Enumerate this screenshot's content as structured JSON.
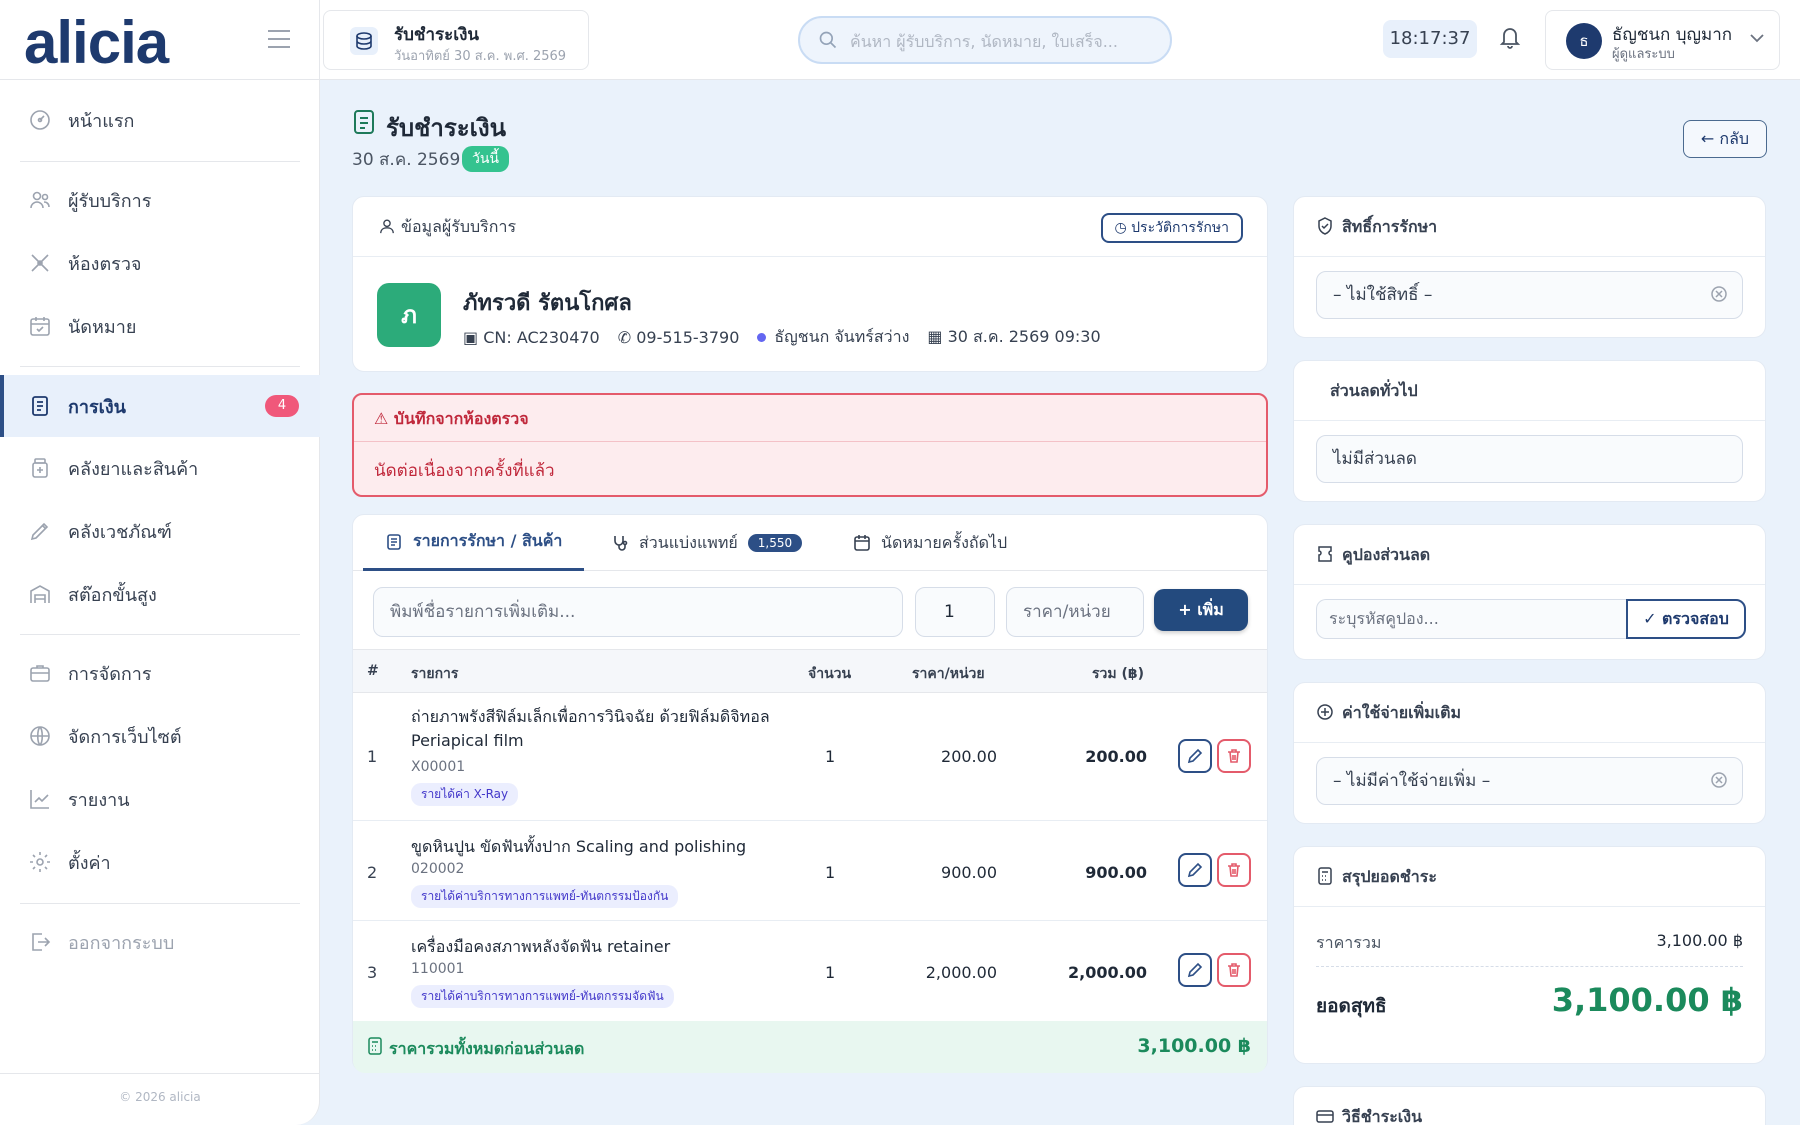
{
  "app": {
    "logo": "alicia",
    "copyright": "© 2026 alicia"
  },
  "sidebar": {
    "items": [
      {
        "label": "หน้าแรก",
        "icon": "dashboard-icon"
      },
      {
        "label": "ผู้รับบริการ",
        "icon": "users-icon"
      },
      {
        "label": "ห้องตรวจ",
        "icon": "exam-room-icon"
      },
      {
        "label": "นัดหมาย",
        "icon": "calendar-icon"
      },
      {
        "label": "การเงิน",
        "icon": "receipt-icon",
        "badge": "4",
        "active": true
      },
      {
        "label": "คลังยาและสินค้า",
        "icon": "medicine-icon"
      },
      {
        "label": "คลังเวชภัณฑ์",
        "icon": "supply-icon"
      },
      {
        "label": "สต๊อกขั้นสูง",
        "icon": "warehouse-icon"
      },
      {
        "label": "การจัดการ",
        "icon": "briefcase-icon"
      },
      {
        "label": "จัดการเว็บไซต์",
        "icon": "globe-icon"
      },
      {
        "label": "รายงาน",
        "icon": "chart-icon"
      },
      {
        "label": "ตั้งค่า",
        "icon": "gear-icon"
      },
      {
        "label": "ออกจากระบบ",
        "icon": "logout-icon"
      }
    ]
  },
  "header": {
    "page_tag_title": "รับชำระเงิน",
    "page_tag_date": "วันอาทิตย์ 30 ส.ค. พ.ศ. 2569",
    "search_placeholder": "ค้นหา ผู้รับบริการ, นัดหมาย, ใบเสร็จ...",
    "clock": "18:17:37",
    "user_initial": "ธ",
    "user_name": "ธัญชนก บุญมาก",
    "user_role": "ผู้ดูแลระบบ"
  },
  "page": {
    "title": "รับชำระเงิน",
    "date": "30 ส.ค. 2569",
    "today_badge": "วันนี้",
    "back_label": "← กลับ"
  },
  "patient": {
    "section_title": "ข้อมูลผู้รับบริการ",
    "history_button": "ประวัติการรักษา",
    "initial": "ภ",
    "name": "ภัทรวดี รัตนโกศล",
    "cn": "CN: AC230470",
    "phone": "09-515-3790",
    "doctor": "ธัญชนก จันทร์สว่าง",
    "visit_datetime": "30 ส.ค. 2569 09:30",
    "doctor_dot_color": "#6366f1"
  },
  "exam_note": {
    "title": "บันทึกจากห้องตรวจ",
    "body": "นัดต่อเนื่องจากครั้งที่แล้ว"
  },
  "tabs": [
    {
      "label": "รายการรักษา / สินค้า"
    },
    {
      "label": "ส่วนแบ่งแพทย์",
      "badge": "1,550"
    },
    {
      "label": "นัดหมายครั้งถัดไป"
    }
  ],
  "add_form": {
    "item_placeholder": "พิมพ์ชื่อรายการเพิ่มเติม...",
    "qty": "1",
    "price_placeholder": "ราคา/หน่วย",
    "add_button": "+ เพิ่ม"
  },
  "table": {
    "headers": {
      "idx": "#",
      "item": "รายการ",
      "qty": "จำนวน",
      "unit_price": "ราคา/หน่วย",
      "total": "รวม (฿)"
    },
    "rows": [
      {
        "idx": "1",
        "name": "ถ่ายภาพรังสีฟิล์มเล็กเพื่อการวินิจฉัย ด้วยฟิล์มดิจิทอล Periapical film",
        "code": "X00001",
        "tag": "รายได้ค่า X-Ray",
        "qty": "1",
        "price": "200.00",
        "total": "200.00"
      },
      {
        "idx": "2",
        "name": "ขูดหินปูน ขัดฟันทั้งปาก Scaling and polishing",
        "code": "020002",
        "tag": "รายได้ค่าบริการทางการแพทย์-ทันตกรรมป้องกัน",
        "qty": "1",
        "price": "900.00",
        "total": "900.00"
      },
      {
        "idx": "3",
        "name": "เครื่องมือคงสภาพหลังจัดฟัน retainer",
        "code": "110001",
        "tag": "รายได้ค่าบริการทางการแพทย์-ทันตกรรมจัดฟัน",
        "qty": "1",
        "price": "2,000.00",
        "total": "2,000.00"
      }
    ],
    "footer_label": "ราคารวมทั้งหมดก่อนส่วนลด",
    "footer_total": "3,100.00 ฿"
  },
  "right": {
    "coverage": {
      "title": "สิทธิ์การรักษา",
      "value": "– ไม่ใช้สิทธิ์ –"
    },
    "discount": {
      "title": "ส่วนลดทั่วไป",
      "value": "ไม่มีส่วนลด"
    },
    "coupon": {
      "title": "คูปองส่วนลด",
      "placeholder": "ระบุรหัสคูปอง...",
      "check_button": "✓ ตรวจสอบ"
    },
    "extra": {
      "title": "ค่าใช้จ่ายเพิ่มเติม",
      "value": "– ไม่มีค่าใช้จ่ายเพิ่ม –"
    },
    "summary": {
      "title": "สรุปยอดชำระ",
      "subtotal_label": "ราคารวม",
      "subtotal": "3,100.00 ฿",
      "net_label": "ยอดสุทธิ",
      "net": "3,100.00 ฿"
    },
    "payment": {
      "title": "วิธีชำระเงิน"
    }
  }
}
